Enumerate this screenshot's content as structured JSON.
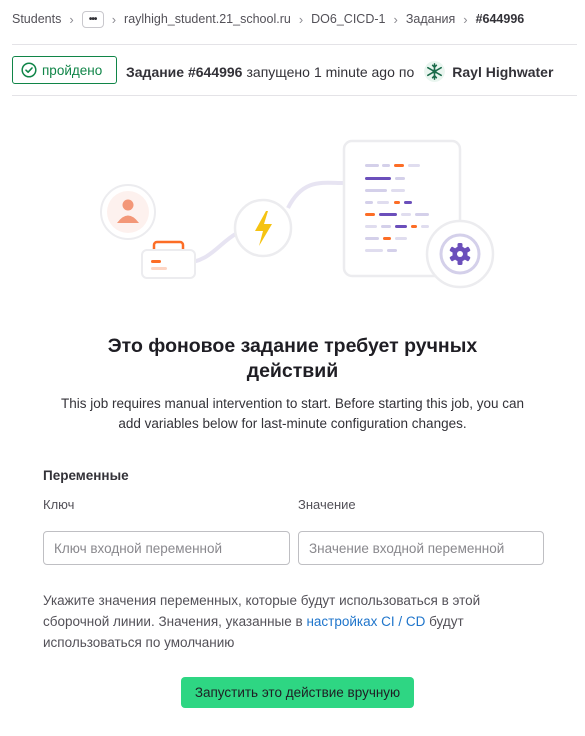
{
  "breadcrumb": {
    "items": [
      "Students",
      "raylhigh_student.21_school.ru",
      "DO6_CICD-1",
      "Задания",
      "#644996"
    ],
    "ellipsis": "•••"
  },
  "job": {
    "status": "пройдено",
    "title": "Задание #644996",
    "started_text": "запущено",
    "time_ago": "1 minute ago",
    "by_text": "по",
    "user": "Rayl Highwater"
  },
  "empty_state": {
    "title": "Это фоновое задание требует ручных действий",
    "description": "This job requires manual intervention to start. Before starting this job, you can add variables below for last-minute configuration changes."
  },
  "variables": {
    "section_title": "Переменные",
    "key_label": "Ключ",
    "value_label": "Значение",
    "key_placeholder": "Ключ входной переменной",
    "value_placeholder": "Значение входной переменной"
  },
  "help": {
    "text_before": "Укажите значения переменных, которые будут использоваться в этой сборочной линии. Значения, указанные в ",
    "link": "настройках CI / CD",
    "text_after": " будут использоваться по умолчанию"
  },
  "actions": {
    "run_button": "Запустить это действие вручную"
  },
  "colors": {
    "success": "#108548",
    "primary_button": "#2ed683",
    "link": "#1f75cb",
    "illustration_purple": "#6b4fbb",
    "illustration_orange": "#fc6d26",
    "illustration_yellow": "#f5c312"
  },
  "icons": {
    "status": "check-circle-icon",
    "bolt": "lightning-bolt-icon",
    "gear": "gear-icon",
    "person": "person-icon",
    "avatar": "snowflake-avatar-icon"
  }
}
